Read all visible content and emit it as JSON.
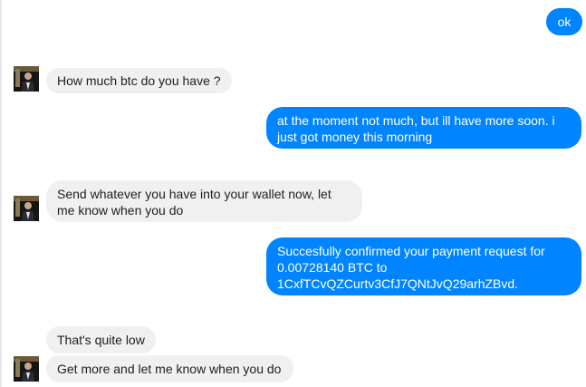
{
  "conversation": {
    "messages": [
      {
        "from": "me",
        "text": "ok"
      },
      {
        "from": "them",
        "text": "How much btc do you have ?"
      },
      {
        "from": "me",
        "text": "at the moment not much, but ill have more soon. i just got money this morning"
      },
      {
        "from": "them",
        "text": "Send whatever you have into your wallet now, let me know when you do"
      },
      {
        "from": "me",
        "text": "Succesfully confirmed your payment request for 0.00728140 BTC to 1CxfTCvQZCurtv3CfJ7QNtJvQ29arhZBvd."
      },
      {
        "from": "them",
        "text": "That's quite low"
      },
      {
        "from": "them",
        "text": "Get more and let me know when you do"
      }
    ]
  },
  "colors": {
    "outgoing_bubble": "#0084ff",
    "incoming_bubble": "#f1f0f0"
  },
  "icons": {
    "contact_avatar": "contact-avatar-photo"
  }
}
